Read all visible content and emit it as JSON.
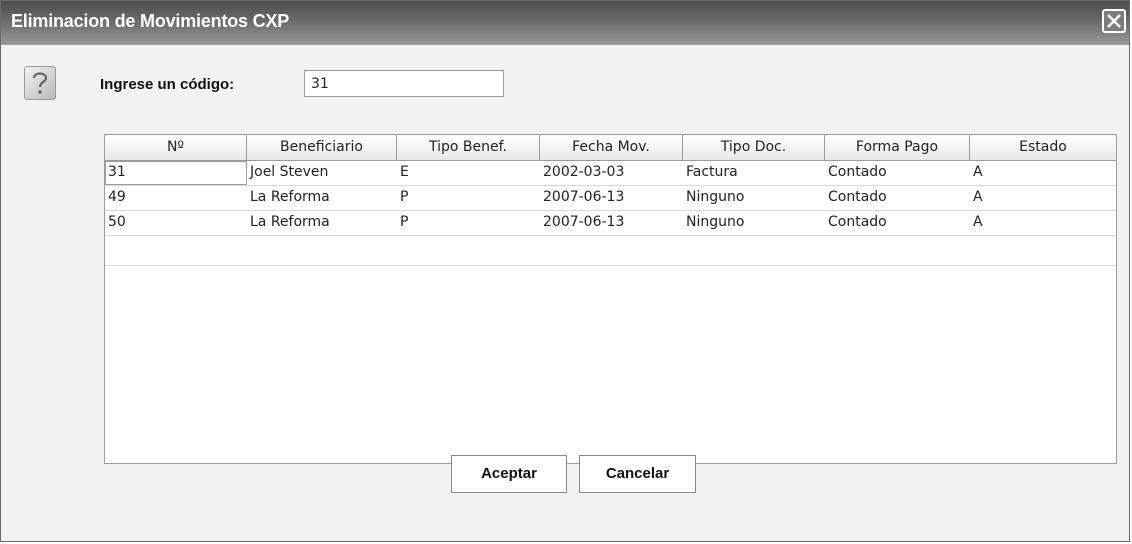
{
  "window": {
    "title": "Eliminacion de Movimientos CXP"
  },
  "form": {
    "code_label": "Ingrese un código:",
    "code_value": "31"
  },
  "table": {
    "columns": [
      "Nº",
      "Beneficiario",
      "Tipo Benef.",
      "Fecha Mov.",
      "Tipo Doc.",
      "Forma Pago",
      "Estado"
    ],
    "rows": [
      [
        "31",
        "Joel Steven",
        "E",
        "2002-03-03",
        "Factura",
        "Contado",
        "A"
      ],
      [
        "49",
        "La Reforma",
        "P",
        "2007-06-13",
        "Ninguno",
        "Contado",
        "A"
      ],
      [
        "50",
        "La Reforma",
        "P",
        "2007-06-13",
        "Ninguno",
        "Contado",
        "A"
      ]
    ]
  },
  "buttons": {
    "accept_label": "Aceptar",
    "cancel_label": "Cancelar"
  },
  "icons": {
    "dialog": "question-icon",
    "close": "close-icon"
  }
}
